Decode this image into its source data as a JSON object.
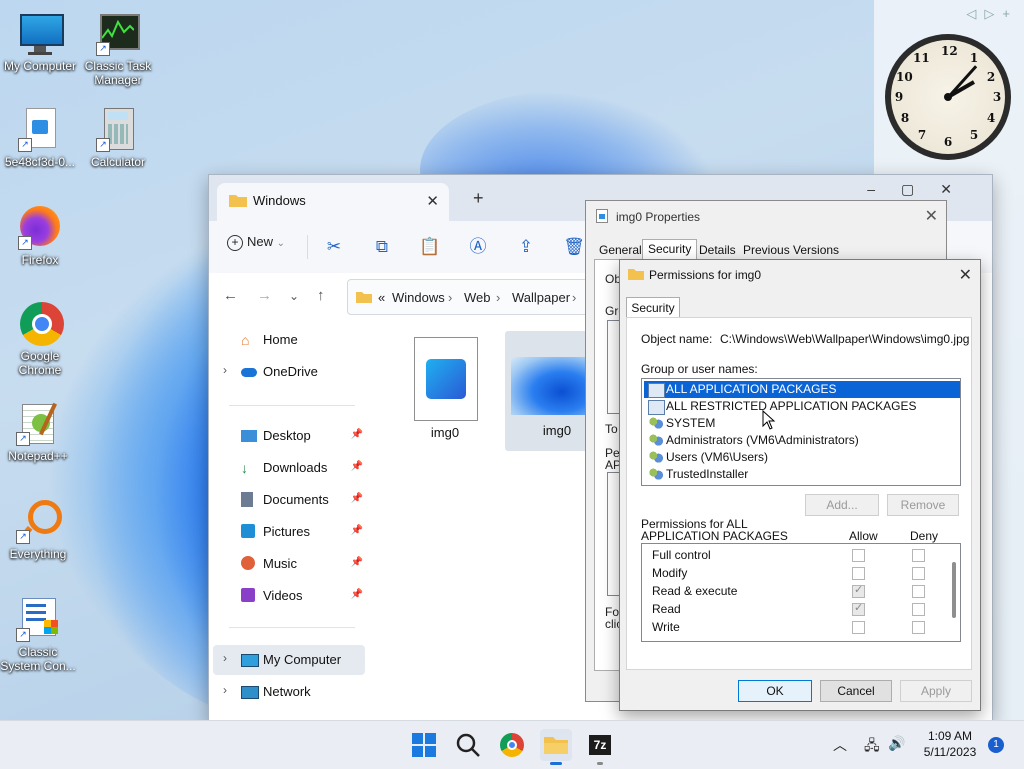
{
  "desktop": {
    "icons": [
      {
        "label": "My Computer"
      },
      {
        "label": "Classic Task Manager"
      },
      {
        "label": "5e48cf3d-0..."
      },
      {
        "label": "Calculator"
      },
      {
        "label": "Firefox"
      },
      {
        "label": "Google Chrome"
      },
      {
        "label": "Notepad++"
      },
      {
        "label": "Everything"
      },
      {
        "label": "Classic System Con..."
      }
    ]
  },
  "explorer": {
    "tab_title": "Windows",
    "new_label": "New",
    "breadcrumb": [
      "«",
      "Windows",
      "›",
      "Web",
      "›",
      "Wallpaper",
      "›"
    ],
    "nav": {
      "home": "Home",
      "onedrive": "OneDrive",
      "desktop": "Desktop",
      "downloads": "Downloads",
      "documents": "Documents",
      "pictures": "Pictures",
      "music": "Music",
      "videos": "Videos",
      "my_computer": "My Computer",
      "network": "Network"
    },
    "files": [
      {
        "name": "img0"
      },
      {
        "name": "img0"
      }
    ]
  },
  "properties": {
    "title": "img0 Properties",
    "tabs": [
      "General",
      "Security",
      "Details",
      "Previous Versions"
    ],
    "fragments": {
      "ob": "Ob",
      "gro": "Gro",
      "to": "To",
      "perm": "Perm",
      "ap": "APP",
      "for": "For",
      "clic": "clic"
    }
  },
  "permissions": {
    "title": "Permissions for img0",
    "tab": "Security",
    "object_name_label": "Object name:",
    "object_name": "C:\\Windows\\Web\\Wallpaper\\Windows\\img0.jpg",
    "groups_label": "Group or user names:",
    "groups": [
      "ALL APPLICATION PACKAGES",
      "ALL RESTRICTED APPLICATION PACKAGES",
      "SYSTEM",
      "Administrators (VM6\\Administrators)",
      "Users (VM6\\Users)",
      "TrustedInstaller"
    ],
    "add_label": "Add...",
    "remove_label": "Remove",
    "perms_for_label": "Permissions for ALL",
    "perms_for_label2": "APPLICATION PACKAGES",
    "allow_label": "Allow",
    "deny_label": "Deny",
    "perm_rows": [
      {
        "name": "Full control",
        "allow": false,
        "deny": false
      },
      {
        "name": "Modify",
        "allow": false,
        "deny": false
      },
      {
        "name": "Read & execute",
        "allow": true,
        "deny": false
      },
      {
        "name": "Read",
        "allow": true,
        "deny": false
      },
      {
        "name": "Write",
        "allow": false,
        "deny": false
      }
    ],
    "ok_label": "OK",
    "cancel_label": "Cancel",
    "apply_label": "Apply"
  },
  "taskbar": {
    "time": "1:09 AM",
    "date": "5/11/2023",
    "notifications": "1"
  },
  "colors": {
    "accent": "#0a64d6",
    "folder": "#f2c14e"
  }
}
